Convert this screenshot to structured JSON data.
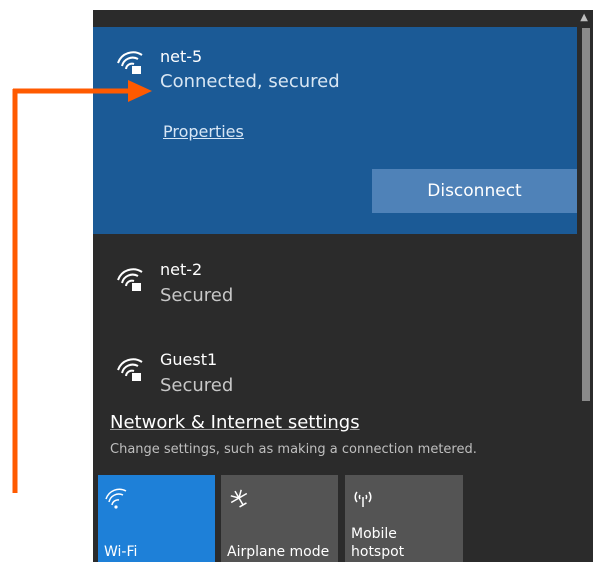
{
  "networks": [
    {
      "name": "net-5",
      "status": "Connected, secured",
      "properties": "Properties",
      "disconnect": "Disconnect"
    },
    {
      "name": "net-2",
      "status": "Secured"
    },
    {
      "name": "Guest1",
      "status": "Secured"
    }
  ],
  "settings": {
    "title": "Network & Internet settings",
    "subtitle": "Change settings, such as making a connection metered."
  },
  "tiles": [
    {
      "label": "Wi-Fi",
      "icon": "wifi-icon",
      "active": true
    },
    {
      "label": "Airplane mode",
      "icon": "airplane-icon",
      "active": false
    },
    {
      "label_line1": "Mobile",
      "label_line2": "hotspot",
      "icon": "hotspot-icon",
      "active": false
    }
  ],
  "colors": {
    "connected_bg": "#1b5a96",
    "panel_bg": "#2b2b2b",
    "wifi_tile": "#1e80d8",
    "annotation_arrow": "#ff5a00"
  }
}
